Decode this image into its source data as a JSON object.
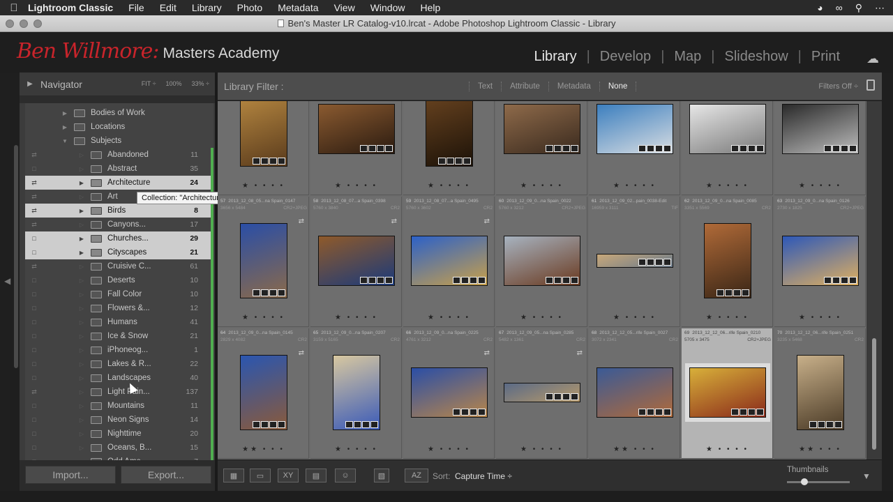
{
  "menubar": {
    "apple": "",
    "app_name": "Lightroom Classic",
    "items": [
      "File",
      "Edit",
      "Library",
      "Photo",
      "Metadata",
      "View",
      "Window",
      "Help"
    ],
    "status_icons": [
      "globe-icon",
      "creative-cloud-icon",
      "search-icon",
      "more-icon"
    ]
  },
  "window": {
    "title": "Ben's Master LR Catalog-v10.lrcat - Adobe Photoshop Lightroom Classic - Library"
  },
  "identity": {
    "signature": "Ben Willmore:",
    "academy": "Masters Academy",
    "modules": [
      "Library",
      "Develop",
      "Map",
      "Slideshow",
      "Print"
    ],
    "active_module": "Library"
  },
  "navigator": {
    "title": "Navigator",
    "fit": "FIT ÷",
    "zoom1": "100%",
    "zoom2": "33% ÷"
  },
  "collections": [
    {
      "name": "Bodies of Work",
      "count": "",
      "level": 1,
      "expander": "▶",
      "selected": false,
      "sync": false
    },
    {
      "name": "Locations",
      "count": "",
      "level": 1,
      "expander": "▶",
      "selected": false,
      "sync": false
    },
    {
      "name": "Subjects",
      "count": "",
      "level": 1,
      "expander": "▼",
      "selected": false,
      "sync": false
    },
    {
      "name": "Abandoned",
      "count": "11",
      "level": 2,
      "expander": "",
      "selected": false,
      "sync": true
    },
    {
      "name": "Abstract",
      "count": "35",
      "level": 2,
      "expander": "",
      "selected": false,
      "sync": false
    },
    {
      "name": "Architecture",
      "count": "24",
      "level": 2,
      "expander": "▶",
      "selected": true,
      "sync": true
    },
    {
      "name": "Art",
      "count": "",
      "level": 2,
      "expander": "",
      "selected": false,
      "sync": true
    },
    {
      "name": "Birds",
      "count": "8",
      "level": 2,
      "expander": "▶",
      "selected": true,
      "sync": true
    },
    {
      "name": "Canyons...",
      "count": "17",
      "level": 2,
      "expander": "",
      "selected": false,
      "sync": true
    },
    {
      "name": "Churches...",
      "count": "29",
      "level": 2,
      "expander": "▶",
      "selected": true,
      "sync": false
    },
    {
      "name": "Cityscapes",
      "count": "21",
      "level": 2,
      "expander": "▶",
      "selected": true,
      "sync": false
    },
    {
      "name": "Cruisive C...",
      "count": "61",
      "level": 2,
      "expander": "",
      "selected": false,
      "sync": true
    },
    {
      "name": "Deserts",
      "count": "10",
      "level": 2,
      "expander": "",
      "selected": false,
      "sync": false
    },
    {
      "name": "Fall Color",
      "count": "10",
      "level": 2,
      "expander": "",
      "selected": false,
      "sync": false
    },
    {
      "name": "Flowers &...",
      "count": "12",
      "level": 2,
      "expander": "",
      "selected": false,
      "sync": false
    },
    {
      "name": "Humans",
      "count": "41",
      "level": 2,
      "expander": "",
      "selected": false,
      "sync": false
    },
    {
      "name": "Ice & Snow",
      "count": "21",
      "level": 2,
      "expander": "",
      "selected": false,
      "sync": false
    },
    {
      "name": "iPhoneog...",
      "count": "1",
      "level": 2,
      "expander": "",
      "selected": false,
      "sync": false
    },
    {
      "name": "Lakes & R...",
      "count": "22",
      "level": 2,
      "expander": "",
      "selected": false,
      "sync": false
    },
    {
      "name": "Landscapes",
      "count": "40",
      "level": 2,
      "expander": "",
      "selected": false,
      "sync": false
    },
    {
      "name": "Light Pain...",
      "count": "137",
      "level": 2,
      "expander": "",
      "selected": false,
      "sync": true
    },
    {
      "name": "Mountains",
      "count": "11",
      "level": 2,
      "expander": "",
      "selected": false,
      "sync": false
    },
    {
      "name": "Neon Signs",
      "count": "14",
      "level": 2,
      "expander": "",
      "selected": false,
      "sync": false
    },
    {
      "name": "Nighttime",
      "count": "20",
      "level": 2,
      "expander": "",
      "selected": false,
      "sync": false
    },
    {
      "name": "Oceans, B...",
      "count": "15",
      "level": 2,
      "expander": "",
      "selected": false,
      "sync": false
    },
    {
      "name": "Odd Ame...",
      "count": "7",
      "level": 2,
      "expander": "",
      "selected": false,
      "sync": false
    }
  ],
  "tooltip": "Collection: \"Architecture\"",
  "panel_buttons": {
    "import": "Import...",
    "export": "Export..."
  },
  "filter": {
    "label": "Library Filter :",
    "options": [
      "Text",
      "Attribute",
      "Metadata",
      "None"
    ],
    "active": "None",
    "filters_off": "Filters Off ÷"
  },
  "grid": {
    "cells": [
      {
        "index": "",
        "file": "",
        "dims": "",
        "ext": "",
        "stars": "★ • • • •",
        "thumb_colors": [
          "#b98a42",
          "#5a3b1c"
        ],
        "aspect": "portrait",
        "selected": false,
        "flag": false
      },
      {
        "index": "",
        "file": "",
        "dims": "",
        "ext": "",
        "stars": "★ • • • •",
        "thumb_colors": [
          "#8a5a30",
          "#2b1b10"
        ],
        "aspect": "landscape",
        "selected": false,
        "flag": false
      },
      {
        "index": "",
        "file": "",
        "dims": "",
        "ext": "",
        "stars": "★ • • • •",
        "thumb_colors": [
          "#6a4420",
          "#1c1208"
        ],
        "aspect": "portrait",
        "selected": false,
        "flag": false
      },
      {
        "index": "",
        "file": "",
        "dims": "",
        "ext": "",
        "stars": "★ • • • •",
        "thumb_colors": [
          "#8e6a4a",
          "#3a2a1e"
        ],
        "aspect": "landscape",
        "selected": false,
        "flag": false
      },
      {
        "index": "",
        "file": "",
        "dims": "",
        "ext": "",
        "stars": "★ • • • •",
        "thumb_colors": [
          "#3c7fbf",
          "#d8dde2"
        ],
        "aspect": "landscape",
        "selected": false,
        "flag": false
      },
      {
        "index": "",
        "file": "",
        "dims": "",
        "ext": "",
        "stars": "★ • • • •",
        "thumb_colors": [
          "#e6e6e6",
          "#7a7a7a"
        ],
        "aspect": "landscape",
        "selected": false,
        "flag": false
      },
      {
        "index": "",
        "file": "",
        "dims": "",
        "ext": "",
        "stars": "★ • • • •",
        "thumb_colors": [
          "#2a2a2a",
          "#bcbcbc"
        ],
        "aspect": "landscape",
        "selected": false,
        "flag": false
      },
      {
        "index": "57",
        "file": "2013_12_08_05...na Spain_0147",
        "dims": "3656 x 5484",
        "ext": "CR2+JPEG",
        "stars": "★ • • • •",
        "thumb_colors": [
          "#2a4ea6",
          "#8a6a4a"
        ],
        "aspect": "portrait",
        "selected": false,
        "flag": true
      },
      {
        "index": "58",
        "file": "2013_12_08_07...a Spain_0398",
        "dims": "5760 x 3840",
        "ext": "CR2",
        "stars": "★ • • • •",
        "thumb_colors": [
          "#8f5a2a",
          "#1b3a7a"
        ],
        "aspect": "landscape",
        "selected": false,
        "flag": true
      },
      {
        "index": "59",
        "file": "2013_12_08_07...a Spain_0495",
        "dims": "5760 x 3602",
        "ext": "CR2",
        "stars": "★ • • • •",
        "thumb_colors": [
          "#2c61c8",
          "#c8a04a"
        ],
        "aspect": "landscape",
        "selected": false,
        "flag": true
      },
      {
        "index": "60",
        "file": "2013_12_09_0...na Spain_0022",
        "dims": "5760 x 3212",
        "ext": "CR2+JPEG",
        "stars": "★ • • • •",
        "thumb_colors": [
          "#a7b3c0",
          "#6a3a20"
        ],
        "aspect": "landscape",
        "selected": false,
        "flag": false
      },
      {
        "index": "61",
        "file": "2013_12_09_02...pain_0038-Edit",
        "dims": "16959 x 3111",
        "ext": "TIF",
        "stars": "★ • • • •",
        "thumb_colors": [
          "#c8a87a",
          "#6a7a8a"
        ],
        "aspect": "pano",
        "selected": false,
        "flag": false
      },
      {
        "index": "62",
        "file": "2013_12_09_0...na Spain_0085",
        "dims": "3351 x 5569",
        "ext": "CR2",
        "stars": "★ • • • •",
        "thumb_colors": [
          "#b06a38",
          "#3a2616"
        ],
        "aspect": "portrait",
        "selected": false,
        "flag": false
      },
      {
        "index": "63",
        "file": "2013_12_09_0...na Spain_0126",
        "dims": "2730 x 1825",
        "ext": "CR2+JPEG",
        "stars": "★ • • • •",
        "thumb_colors": [
          "#2d58b8",
          "#e0b060"
        ],
        "aspect": "landscape",
        "selected": false,
        "flag": false
      },
      {
        "index": "64",
        "file": "2013_12_09_0...na Spain_0145",
        "dims": "2829 x 4082",
        "ext": "CR2",
        "stars": "★★ • • •",
        "thumb_colors": [
          "#2a56b0",
          "#8a5a3a"
        ],
        "aspect": "portrait",
        "selected": false,
        "flag": true
      },
      {
        "index": "65",
        "file": "2013_12_09_0...na Spain_0207",
        "dims": "3159 x 5165",
        "ext": "CR2",
        "stars": "★ • • • •",
        "thumb_colors": [
          "#d8c8a0",
          "#3a5ab8"
        ],
        "aspect": "portrait",
        "selected": false,
        "flag": false
      },
      {
        "index": "66",
        "file": "2013_12_09_0...na Spain_0225",
        "dims": "4761 x 3212",
        "ext": "CR2",
        "stars": "★ • • • •",
        "thumb_colors": [
          "#2a4ea6",
          "#b8864a"
        ],
        "aspect": "landscape",
        "selected": false,
        "flag": true
      },
      {
        "index": "67",
        "file": "2013_12_09_05...na Spain_0285",
        "dims": "5482 x 1361",
        "ext": "CR2",
        "stars": "★ • • • •",
        "thumb_colors": [
          "#5a6a86",
          "#b89a6a"
        ],
        "aspect": "pano",
        "selected": false,
        "flag": true
      },
      {
        "index": "68",
        "file": "2013_12_12_05...rife Spain_0027",
        "dims": "3072 x 2341",
        "ext": "CR2",
        "stars": "★★ • • •",
        "thumb_colors": [
          "#3a5a96",
          "#b06a3a"
        ],
        "aspect": "landscape",
        "selected": false,
        "flag": false
      },
      {
        "index": "69",
        "file": "2013_12_12_06...rife Spain_0210",
        "dims": "5705 x 3475",
        "ext": "CR2+JPEG",
        "stars": "★ • • • •",
        "thumb_colors": [
          "#d8b03a",
          "#8a2a1a"
        ],
        "aspect": "landscape",
        "selected": true,
        "flag": false
      },
      {
        "index": "70",
        "file": "2013_12_12_06...rife Spain_0251",
        "dims": "3235 x 5468",
        "ext": "CR2",
        "stars": "★★ • • •",
        "thumb_colors": [
          "#c8b08a",
          "#4a3a26"
        ],
        "aspect": "portrait",
        "selected": false,
        "flag": false
      }
    ]
  },
  "toolbar": {
    "sort_label": "Sort:",
    "sort_value": "Capture Time ÷",
    "thumbnails_label": "Thumbnails",
    "thumbnail_size": 0.28,
    "view_icons": [
      "grid-view-icon",
      "loupe-view-icon",
      "compare-view-icon",
      "survey-view-icon",
      "people-view-icon"
    ]
  },
  "colors": {
    "accent_red": "#c8242b",
    "green_marker": "#4fae4f"
  }
}
